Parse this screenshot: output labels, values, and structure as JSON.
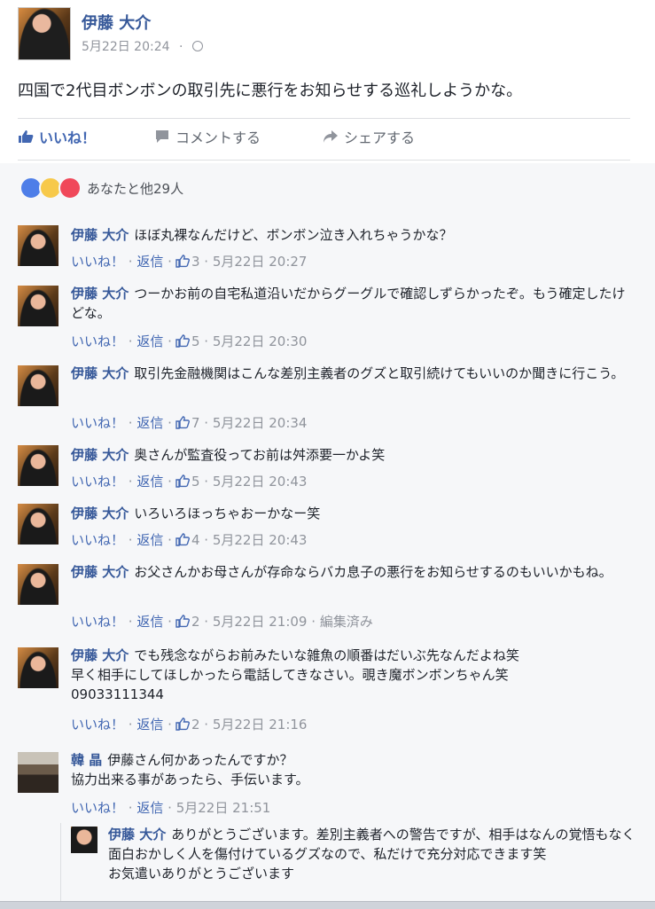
{
  "post": {
    "author": "伊藤 大介",
    "timestamp": "5月22日 20:24",
    "privacy_separator": "·",
    "text": "四国で2代目ボンボンの取引先に悪行をお知らせする巡礼しようかな。"
  },
  "actions": {
    "like": "いいね！",
    "comment": "コメントする",
    "share": "シェアする"
  },
  "colors": {
    "link": "#365899",
    "like_blue": "#4267b2",
    "meta_gray": "#90949c"
  },
  "reactions": {
    "icons": [
      "like-icon",
      "haha-icon",
      "love-icon"
    ],
    "summary": "あなたと他29人"
  },
  "comment_actions": {
    "like": "いいね！",
    "reply": "返信",
    "sep": "·"
  },
  "comments": [
    {
      "author": "伊藤 大介",
      "text": "ほぼ丸裸なんだけど、ボンボン泣き入れちゃうかな？",
      "likes": "3",
      "time": "5月22日 20:27",
      "edited": ""
    },
    {
      "author": "伊藤 大介",
      "text": "つーかお前の自宅私道沿いだからグーグルで確認しずらかったぞ。もう確定したけどな。",
      "likes": "5",
      "time": "5月22日 20:30",
      "edited": ""
    },
    {
      "author": "伊藤 大介",
      "text": "取引先金融機関はこんな差別主義者のグズと取引続けてもいいのか聞きに行こう。",
      "likes": "7",
      "time": "5月22日 20:34",
      "edited": ""
    },
    {
      "author": "伊藤 大介",
      "text": "奥さんが監査役ってお前は舛添要一かよ笑",
      "likes": "5",
      "time": "5月22日 20:43",
      "edited": ""
    },
    {
      "author": "伊藤 大介",
      "text": "いろいろほっちゃおーかなー笑",
      "likes": "4",
      "time": "5月22日 20:43",
      "edited": ""
    },
    {
      "author": "伊藤 大介",
      "text": "お父さんかお母さんが存命ならバカ息子の悪行をお知らせするのもいいかもね。",
      "likes": "2",
      "time": "5月22日 21:09",
      "edited": "編集済み"
    },
    {
      "author": "伊藤 大介",
      "text": "でも残念ながらお前みたいな雑魚の順番はだいぶ先なんだよね笑\n早く相手にしてほしかったら電話してきなさい。覗き魔ボンボンちゃん笑\n09033111344",
      "likes": "2",
      "time": "5月22日 21:16",
      "edited": ""
    },
    {
      "author": "韓 晶",
      "text": "伊藤さん何かあったんですか？\n協力出来る事があったら、手伝います。",
      "likes": "",
      "time": "5月22日 21:51",
      "edited": ""
    }
  ],
  "reply": {
    "author": "伊藤 大介",
    "text": "ありがとうございます。差別主義者への警告ですが、相手はなんの覚悟もなく面白おかしく人を傷付けているグズなので、私だけで充分対応できます笑\nお気遣いありがとうございます"
  }
}
